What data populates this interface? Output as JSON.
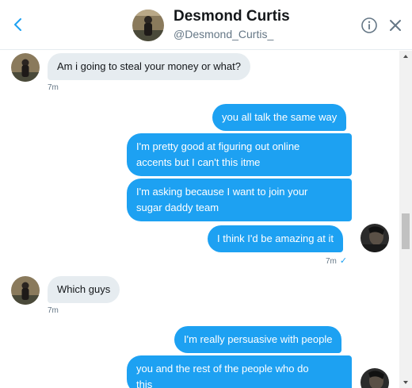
{
  "header": {
    "name": "Desmond Curtis",
    "handle": "@Desmond_Curtis_"
  },
  "icons": {
    "back": "chevron-left-icon",
    "info": "info-icon",
    "close": "close-icon"
  },
  "colors": {
    "accent": "#1da1f2",
    "incoming_bubble": "#e6ecf0",
    "muted_text": "#657786"
  },
  "messages": [
    {
      "direction": "in",
      "text": "Am i going to steal your money or what?",
      "time": "7m"
    },
    {
      "direction": "out",
      "text": "you all talk the same way"
    },
    {
      "direction": "out",
      "line1": "I'm pretty good at figuring out online",
      "line2": "accents but I can't this itme"
    },
    {
      "direction": "out",
      "line1": "I'm asking because I want to join your",
      "line2": "sugar daddy team"
    },
    {
      "direction": "out",
      "text": "I think I'd be amazing at it",
      "time": "7m",
      "status": "✓"
    },
    {
      "direction": "in",
      "text": "Which  guys",
      "time": "7m"
    },
    {
      "direction": "out",
      "text": "I'm really persuasive with people"
    },
    {
      "direction": "out",
      "line1": "you and the rest of the people who do",
      "line2": "this"
    }
  ]
}
